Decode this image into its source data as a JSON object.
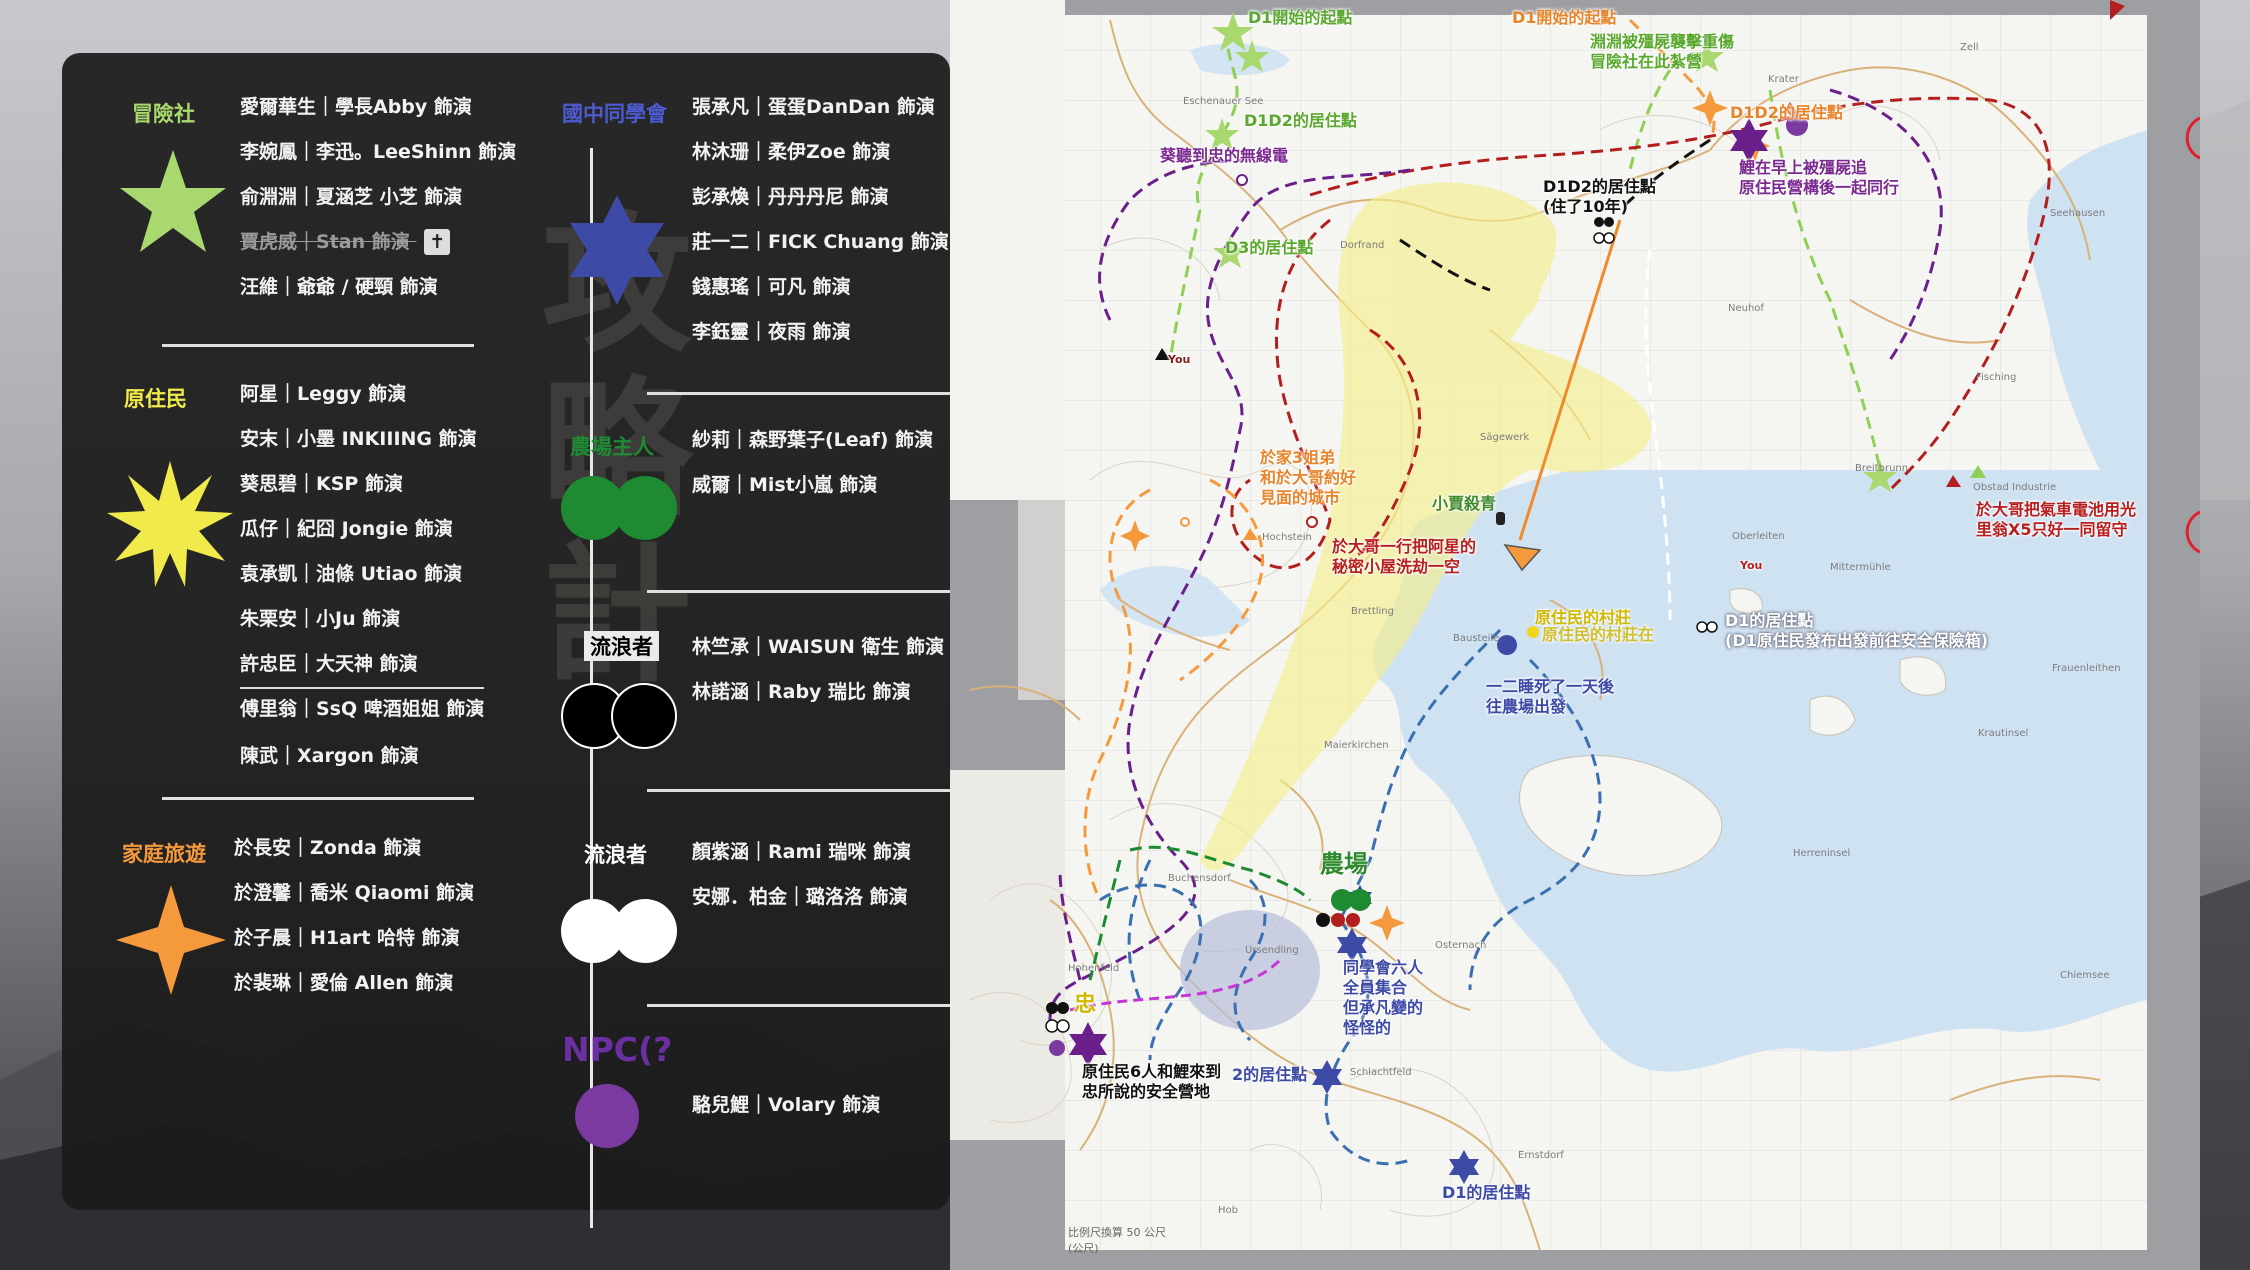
{
  "colors": {
    "adventure": "#a8d86e",
    "native": "#f0eb4a",
    "family": "#f59a3c",
    "classmates": "#3d4aa6",
    "farm": "#1e8a32",
    "npc": "#7b3aa0",
    "red_route": "#b31e1e",
    "purple_route": "#6a1f8a",
    "blue_route": "#3a6fb0",
    "panel": "#1c1b1b"
  },
  "legend": {
    "groups": [
      {
        "id": "adventure",
        "title": "冒險社",
        "symbol": "star5",
        "members": [
          "愛爾華生｜學長Abby 飾演",
          "李婉鳳｜李迅。LeeShinn 飾演",
          "俞淵淵｜夏涵芝 小芝 飾演",
          "賈虎威｜Stan 飾演",
          "汪維｜爺爺 / 硬頸 飾演"
        ],
        "dead_index": 3,
        "dead_icon": "✝"
      },
      {
        "id": "native",
        "title": "原住民",
        "symbol": "burst",
        "members": [
          "阿星｜Leggy 飾演",
          "安末｜小墨 INKIIING 飾演",
          "葵思碧｜KSP 飾演",
          "瓜仔｜紀囧 Jongie 飾演",
          "袁承凱｜油條 Utiao 飾演",
          "朱栗安｜小Ju 飾演",
          "許忠臣｜大天神 飾演",
          "傅里翁｜SsQ 啤酒姐姐 飾演",
          "陳武｜Xargon 飾演"
        ]
      },
      {
        "id": "family",
        "title": "家庭旅遊",
        "symbol": "star4",
        "members": [
          "於長安｜Zonda 飾演",
          "於澄馨｜喬米 Qiaomi 飾演",
          "於子晨｜H1art 哈特 飾演",
          "於裴琳｜愛倫 Allen 飾演"
        ]
      },
      {
        "id": "classmates",
        "title": "國中同學會",
        "symbol": "star6",
        "members": [
          "張承凡｜蛋蛋DanDan 飾演",
          "林沐珊｜柔伊Zoe 飾演",
          "彭承煥｜丹丹丹尼 飾演",
          "莊一二｜FICK Chuang 飾演",
          "錢惠瑤｜可凡 飾演",
          "李鈺靈｜夜雨 飾演"
        ]
      },
      {
        "id": "farm",
        "title": "農場主人",
        "symbol": "double-green",
        "members": [
          "紗莉｜森野葉子(Leaf) 飾演",
          "威爾｜Mist小嵐 飾演"
        ]
      },
      {
        "id": "wanderer_black",
        "title": "流浪者",
        "symbol": "double-black",
        "members": [
          "林竺承｜WAISUN 衛生 飾演",
          "林諾涵｜Raby 瑞比 飾演"
        ]
      },
      {
        "id": "wanderer_white",
        "title": "流浪者",
        "symbol": "double-white",
        "members": [
          "顏紫涵｜Rami 瑞咪 飾演",
          "安娜．柏金｜璐洛洛 飾演"
        ]
      },
      {
        "id": "npc",
        "title": "NPC(?",
        "symbol": "dot-purple",
        "members": [
          "駱兒鯉｜Volary 飾演"
        ]
      }
    ]
  },
  "map": {
    "labels": [
      {
        "id": "d1-start-adventure",
        "text": "D1開始的起點",
        "color": "#5aa82e"
      },
      {
        "id": "d1-start-family",
        "text": "D1開始的起點",
        "color": "#e8842a"
      },
      {
        "id": "d1d2-native-home",
        "text": "D1D2的居住點",
        "color": "#5aa82e"
      },
      {
        "id": "abyss-attack",
        "text": "淵淵被殭屍襲擊重傷\n冒險社在此紮營",
        "color": "#5aa82e"
      },
      {
        "id": "d1d2-family-home",
        "text": "D1D2的居住點",
        "color": "#e8842a"
      },
      {
        "id": "radio",
        "text": "葵聽到忠的無線電",
        "color": "#7b2a90"
      },
      {
        "id": "d1d2-home-10y",
        "text": "D1D2的居住點\n(住了10年)",
        "color": "#111111"
      },
      {
        "id": "carp-chased",
        "text": "鯉在早上被殭屍追\n原住民營構後一起同行",
        "color": "#7b2a90"
      },
      {
        "id": "d3-home",
        "text": "D3的居住點",
        "color": "#5aa82e"
      },
      {
        "id": "you1",
        "text": "You",
        "color": "#8a1c1c"
      },
      {
        "id": "city-meet",
        "text": "於家3姐弟\n和於大哥約好\n見面的城市",
        "color": "#e8842a"
      },
      {
        "id": "xiaojia-killed",
        "text": "小賈殺青",
        "color": "#3f8a2e"
      },
      {
        "id": "cabin-robbed",
        "text": "於大哥一行把阿星的\n秘密小屋洗劫一空",
        "color": "#b81e1e"
      },
      {
        "id": "battery",
        "text": "於大哥把氣車電池用光\n里翁X5只好一同留守",
        "color": "#b81e1e"
      },
      {
        "id": "you2",
        "text": "You",
        "color": "#b81e1e"
      },
      {
        "id": "native-village",
        "text": "原住民的村莊",
        "color": "#d1b800"
      },
      {
        "id": "native-village-ghost",
        "text": "原住民的村莊在",
        "color": "#d1b800"
      },
      {
        "id": "d1-native-home",
        "text": "D1的居住點\n(D1原住民發布出發前往安全保險箱)",
        "color": "#ffffff"
      },
      {
        "id": "one-two-died",
        "text": "一二睡死了一天後\n往農場出發",
        "color": "#3d4aa6"
      },
      {
        "id": "farm",
        "text": "農場",
        "color": "#2e8a2e"
      },
      {
        "id": "classmates-gather",
        "text": "同學會六人\n全員集合\n但承凡變的\n怪怪的",
        "color": "#3d4aa6"
      },
      {
        "id": "zhong",
        "text": "忠",
        "color": "#d1b800"
      },
      {
        "id": "native6",
        "text": "原住民6人和鯉來到\n忠所說的安全營地",
        "color": "#111111"
      },
      {
        "id": "d2-home",
        "text": "2的居住點",
        "color": "#3d4aa6"
      },
      {
        "id": "d1-classmates-home",
        "text": "D1的居住點",
        "color": "#3d4aa6"
      }
    ],
    "places": [
      "Eschenauer See",
      "Krater",
      "Zell",
      "Seehausen",
      "Neuhof",
      "Sägewerk",
      "Fisching",
      "Breitbrunn",
      "Obstad Industrie",
      "Oberleiten",
      "Mittermühle",
      "Dorfrand",
      "Hochstein",
      "Brettling",
      "Bausteile",
      "Frauenleithen",
      "Maierkirchen",
      "Krautinsel",
      "Buchensdorf",
      "Herreninsel",
      "Ursendling",
      "Osternach",
      "Chiemsee",
      "Schlachtfeld",
      "Ernstdorf",
      "Hob",
      "Hohenfeld"
    ],
    "scale_text": "比例尺換算 50 公尺",
    "scale_unit": "(公尺)"
  }
}
